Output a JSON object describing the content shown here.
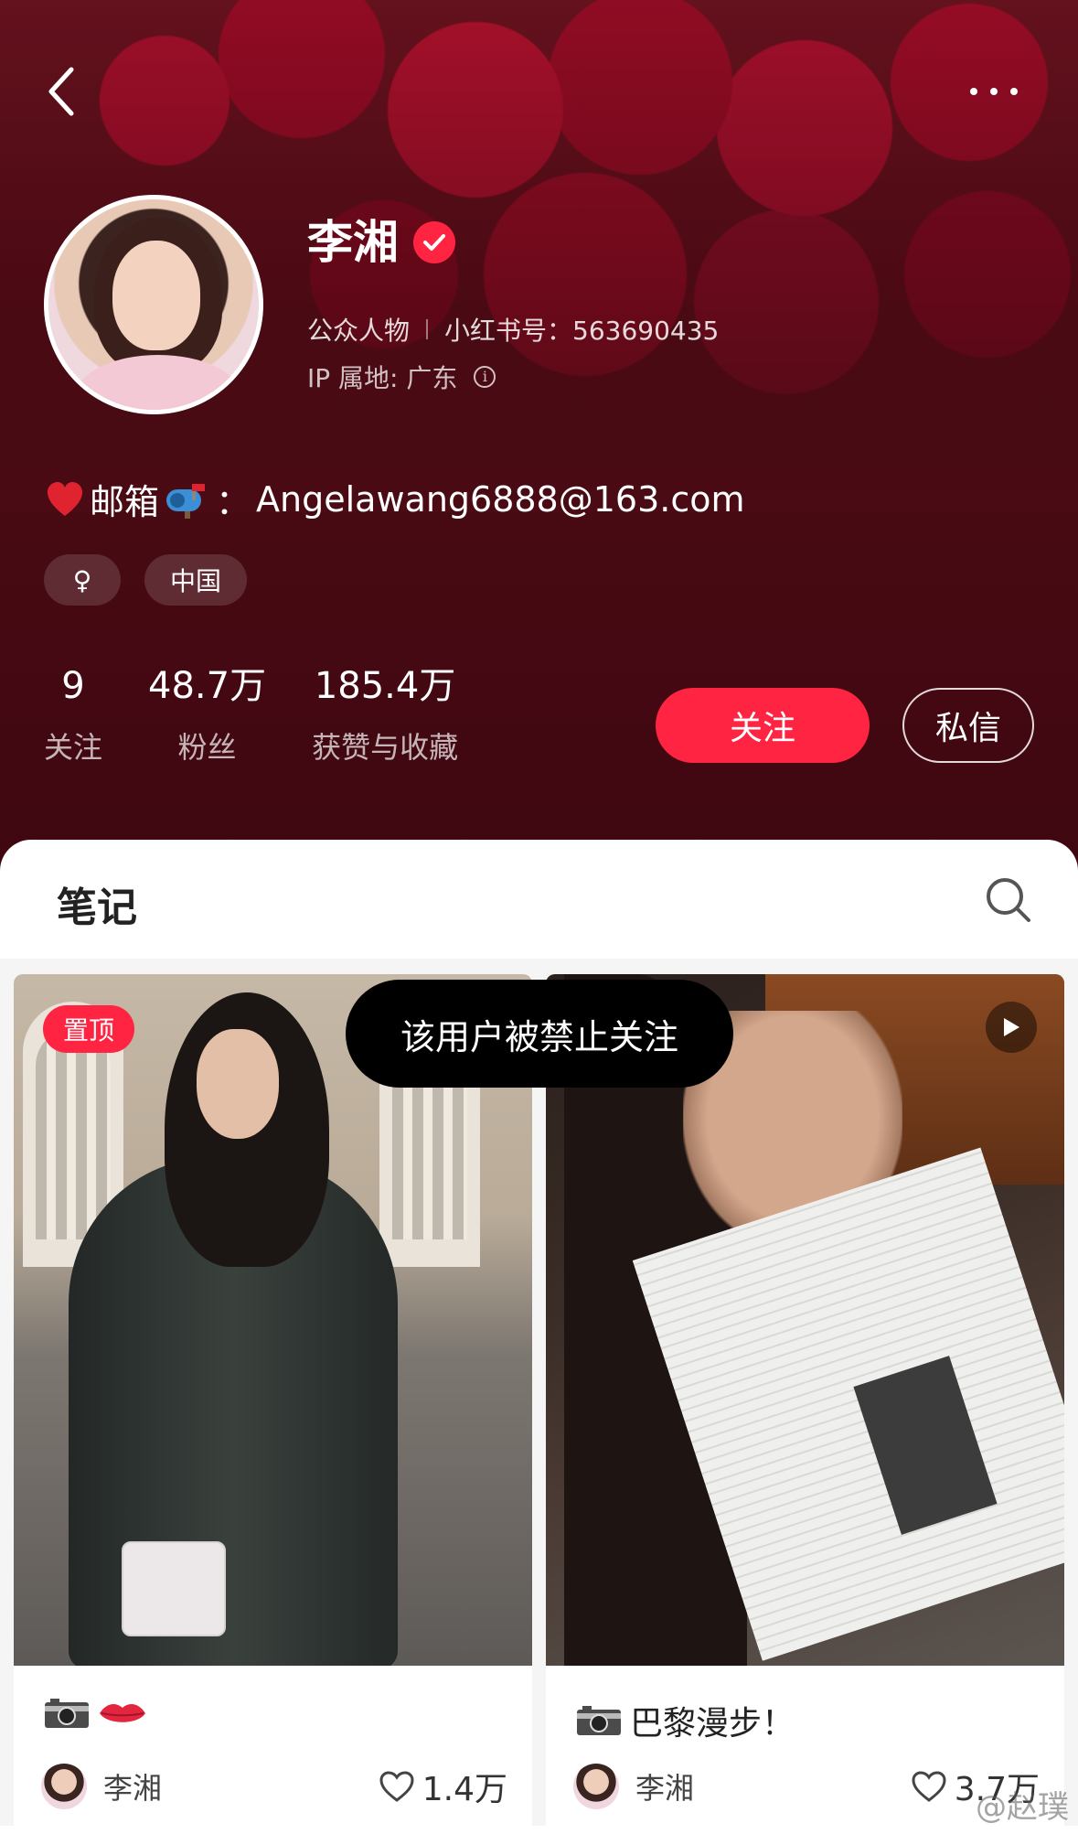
{
  "profile": {
    "name": "李湘",
    "category": "公众人物",
    "red_id_label": "小红书号：",
    "red_id": "563690435",
    "ip_label": "IP 属地: ",
    "ip_location": "广东",
    "bio_mail_label": "邮箱",
    "bio_colon": "：",
    "bio_email": "Angelawang6888@163.com",
    "tags": {
      "gender": "♀",
      "region": "中国"
    }
  },
  "stats": [
    {
      "value": "9",
      "label": "关注"
    },
    {
      "value": "48.7万",
      "label": "粉丝"
    },
    {
      "value": "185.4万",
      "label": "获赞与收藏"
    }
  ],
  "actions": {
    "follow": "关注",
    "message": "私信"
  },
  "tabs": {
    "notes": "笔记"
  },
  "notes": [
    {
      "badge": "置顶",
      "title": "",
      "author": "李湘",
      "likes": "1.4万",
      "has_video": false
    },
    {
      "badge": "",
      "title": "巴黎漫步！",
      "author": "李湘",
      "likes": "3.7万",
      "has_video": true
    }
  ],
  "toast": "该用户被禁止关注",
  "watermark": "@赵璞",
  "colors": {
    "accent": "#ff2442",
    "header_bg": "#4a0b14"
  }
}
